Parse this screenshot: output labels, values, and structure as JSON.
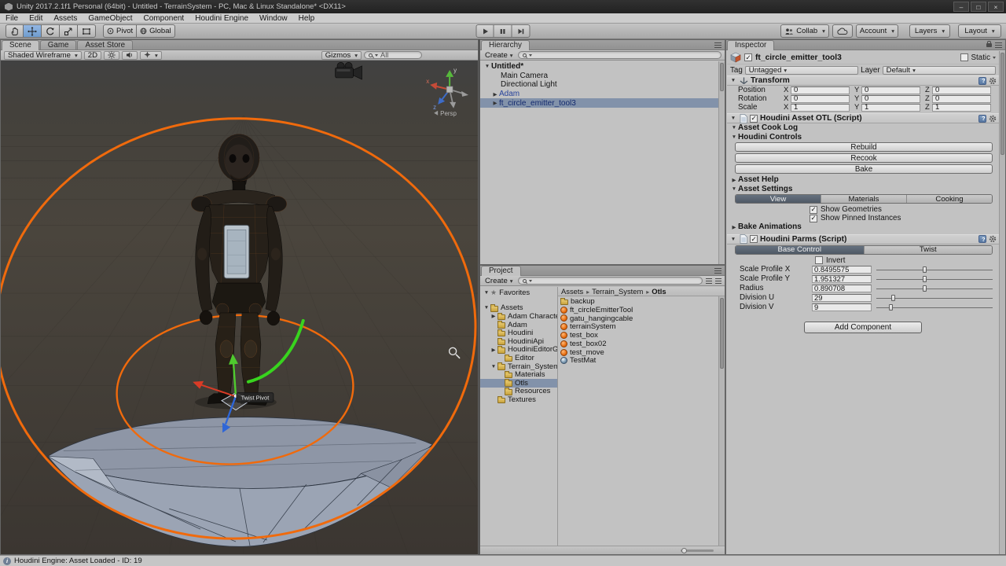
{
  "window": {
    "title": "Unity 2017.2.1f1 Personal (64bit) - Untitled - TerrainSystem - PC, Mac & Linux Standalone* <DX11>"
  },
  "menu": {
    "items": [
      "File",
      "Edit",
      "Assets",
      "GameObject",
      "Component",
      "Houdini Engine",
      "Window",
      "Help"
    ]
  },
  "toolbar": {
    "pivot": "Pivot",
    "global": "Global",
    "collab": "Collab",
    "account": "Account",
    "layers": "Layers",
    "layout": "Layout"
  },
  "scene": {
    "tabs": [
      "Scene",
      "Game",
      "Asset Store"
    ],
    "draw_mode": "Shaded Wireframe",
    "mode_2d": "2D",
    "gizmos_label": "Gizmos",
    "search_text": "All",
    "axis_x": "x",
    "axis_y": "y",
    "axis_z": "z",
    "persp": "Persp",
    "twist_pivot": "Twist Pivot"
  },
  "hierarchy": {
    "tab": "Hierarchy",
    "create": "Create",
    "items": [
      {
        "label": "Untitled*"
      },
      {
        "label": "Main Camera"
      },
      {
        "label": "Directional Light"
      },
      {
        "label": "Adam"
      },
      {
        "label": "ft_circle_emitter_tool3"
      }
    ]
  },
  "project": {
    "tab": "Project",
    "create": "Create",
    "tree": [
      {
        "label": "Favorites"
      },
      {
        "label": "Assets"
      },
      {
        "label": "Adam Characte..."
      },
      {
        "label": "Adam"
      },
      {
        "label": "Houdini"
      },
      {
        "label": "HoudiniApi"
      },
      {
        "label": "HoudiniEditorGU..."
      },
      {
        "label": "Editor"
      },
      {
        "label": "Terrain_System"
      },
      {
        "label": "Materials"
      },
      {
        "label": "Otls"
      },
      {
        "label": "Resources"
      },
      {
        "label": "Textures"
      }
    ],
    "breadcrumb": [
      "Assets",
      "Terrain_System",
      "Otls"
    ],
    "files": [
      {
        "name": "backup",
        "type": "folder"
      },
      {
        "name": "ft_circleEmitterTool",
        "type": "houdini"
      },
      {
        "name": "gatu_hangingcable",
        "type": "houdini"
      },
      {
        "name": "terrainSystem",
        "type": "houdini"
      },
      {
        "name": "test_box",
        "type": "houdini"
      },
      {
        "name": "test_box02",
        "type": "houdini"
      },
      {
        "name": "test_move",
        "type": "houdini"
      },
      {
        "name": "TestMat",
        "type": "material"
      }
    ]
  },
  "inspector": {
    "tab": "Inspector",
    "object_name": "ft_circle_emitter_tool3",
    "static_label": "Static",
    "tag_label": "Tag",
    "tag_value": "Untagged",
    "layer_label": "Layer",
    "layer_value": "Default",
    "transform": {
      "title": "Transform",
      "x": "X",
      "y": "Y",
      "z": "Z",
      "rows": [
        {
          "label": "Position",
          "x": "0",
          "y": "0",
          "z": "0"
        },
        {
          "label": "Rotation",
          "x": "0",
          "y": "0",
          "z": "0"
        },
        {
          "label": "Scale",
          "x": "1",
          "y": "1",
          "z": "1"
        }
      ]
    },
    "houdini_asset": "Houdini Asset OTL (Script)",
    "asset_cook_log": "Asset Cook Log",
    "houdini_controls": "Houdini Controls",
    "rebuild": "Rebuild",
    "recook": "Recook",
    "bake": "Bake",
    "asset_help": "Asset Help",
    "asset_settings": "Asset Settings",
    "settings_tabs": [
      "View",
      "Materials",
      "Cooking"
    ],
    "show_geometries": "Show Geometries",
    "show_pinned": "Show Pinned Instances",
    "bake_animations": "Bake Animations",
    "houdini_parms": "Houdini Parms (Script)",
    "parm_tabs": [
      "Base Control",
      "Twist"
    ],
    "invert": "Invert",
    "params": [
      {
        "label": "Scale Profile X",
        "value": "0.8495575",
        "slider_pos": 0.4
      },
      {
        "label": "Scale Profile Y",
        "value": "1.951327",
        "slider_pos": 0.4
      },
      {
        "label": "Radius",
        "value": "0.890708",
        "slider_pos": 0.4
      },
      {
        "label": "Division U",
        "value": "29",
        "slider_pos": 0.13
      },
      {
        "label": "Division V",
        "value": "9",
        "slider_pos": 0.11
      }
    ],
    "add_component": "Add Component"
  },
  "status": {
    "text": "Houdini Engine: Asset Loaded - ID: 19"
  },
  "icons": {
    "search": "magnifier",
    "dropdown_arrow": "▾",
    "foldout_open": "▼",
    "foldout_closed": "▶",
    "checkmark": "✓",
    "breadcrumb_separator": "▸",
    "favorites_star": "★",
    "info": "i"
  }
}
